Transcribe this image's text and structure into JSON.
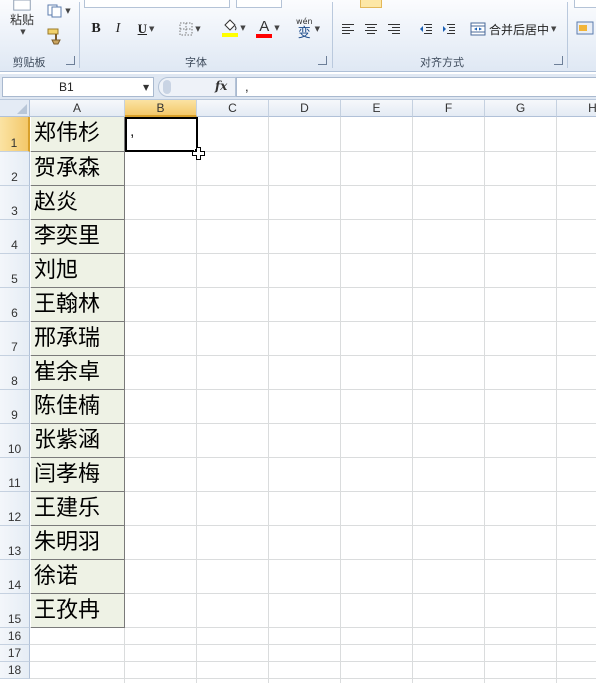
{
  "ribbon": {
    "clipboard": {
      "label": "剪贴板",
      "paste_label": "粘贴"
    },
    "font": {
      "label": "字体",
      "bold": "B",
      "italic": "I",
      "underline": "U",
      "font_color_letter": "A",
      "wen_label": "wén",
      "wen_char": "变",
      "fill_color": "#ffff00",
      "font_color": "#ff0000"
    },
    "alignment": {
      "label": "对齐方式",
      "merge_center_label": "合并后居中"
    }
  },
  "formula_bar": {
    "name_box": "B1",
    "fx": "fx",
    "content": ","
  },
  "sheet": {
    "columns": [
      "A",
      "B",
      "C",
      "D",
      "E",
      "F",
      "G",
      "H"
    ],
    "rows": [
      "1",
      "2",
      "3",
      "4",
      "5",
      "6",
      "7",
      "8",
      "9",
      "10",
      "11",
      "12",
      "13",
      "14",
      "15",
      "16",
      "17",
      "18"
    ],
    "active_cell": {
      "ref": "B1",
      "value": ","
    },
    "names": [
      "郑伟杉",
      "贺承森",
      "赵炎",
      "李奕里",
      "刘旭",
      "王翰林",
      "邢承瑞",
      "崔余卓",
      "陈佳楠",
      "张紫涵",
      "闫孝梅",
      "王建乐",
      "朱明羽",
      "徐诺",
      "王孜冉"
    ]
  }
}
